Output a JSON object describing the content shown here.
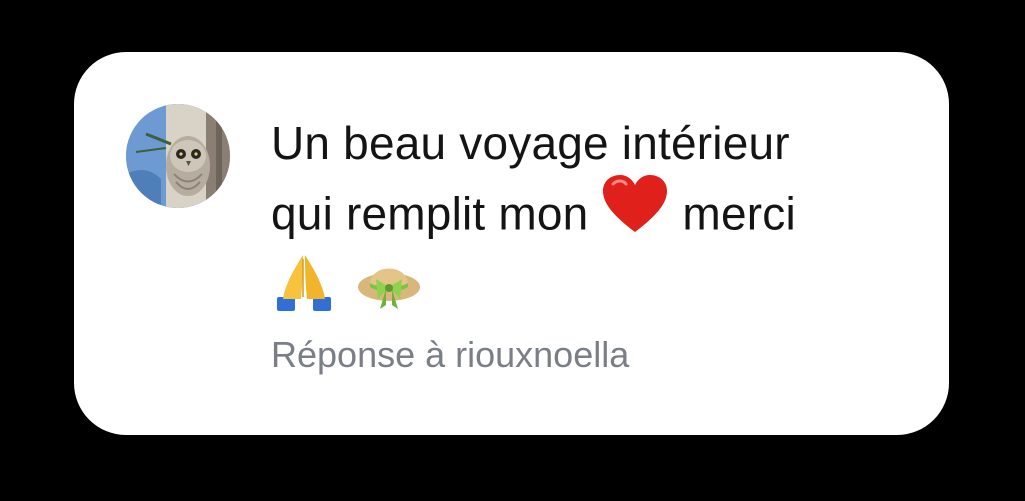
{
  "comment": {
    "line1": "Un beau voyage intérieur",
    "line2_before": "qui remplit mon",
    "line2_after": "merci",
    "emojis": [
      "heart-emoji",
      "praying-hands-emoji",
      "hat-with-bow-emoji"
    ]
  },
  "reply_label": "Réponse à riouxnoella",
  "avatar": {
    "icon": "owl-avatar"
  },
  "colors": {
    "background": "#000000",
    "card": "#ffffff",
    "text": "#141414",
    "reply_text": "#7a7f87",
    "heart": "#e0201b"
  }
}
